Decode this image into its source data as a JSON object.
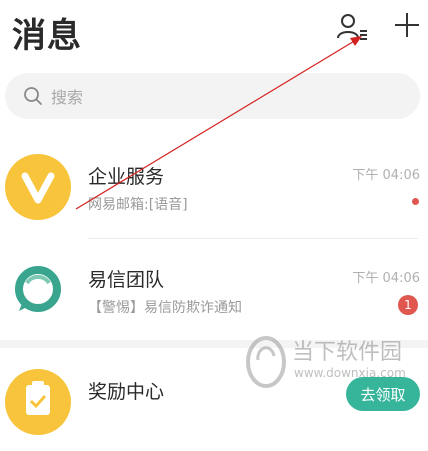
{
  "header": {
    "title": "消息"
  },
  "search": {
    "placeholder": "搜索",
    "value": ""
  },
  "conversations": [
    {
      "title": "企业服务",
      "subtitle": "网易邮箱:[语音]",
      "time": "下午 04:06",
      "indicator": "dot",
      "avatar_color": "#f8c43b",
      "avatar_letter": "V"
    },
    {
      "title": "易信团队",
      "subtitle": "【警惕】易信防欺诈通知",
      "time": "下午 04:06",
      "badge": "1",
      "avatar_color": "#3aa58f"
    },
    {
      "title": "奖励中心",
      "button_label": "去领取",
      "avatar_color": "#f8c43b"
    }
  ],
  "watermark": {
    "text": "当下软件园",
    "url": "www.downxia.com"
  },
  "colors": {
    "accent": "#37b59a",
    "badge": "#e0574f",
    "avatar_yellow": "#f8c43b",
    "annotation": "#d32020"
  }
}
